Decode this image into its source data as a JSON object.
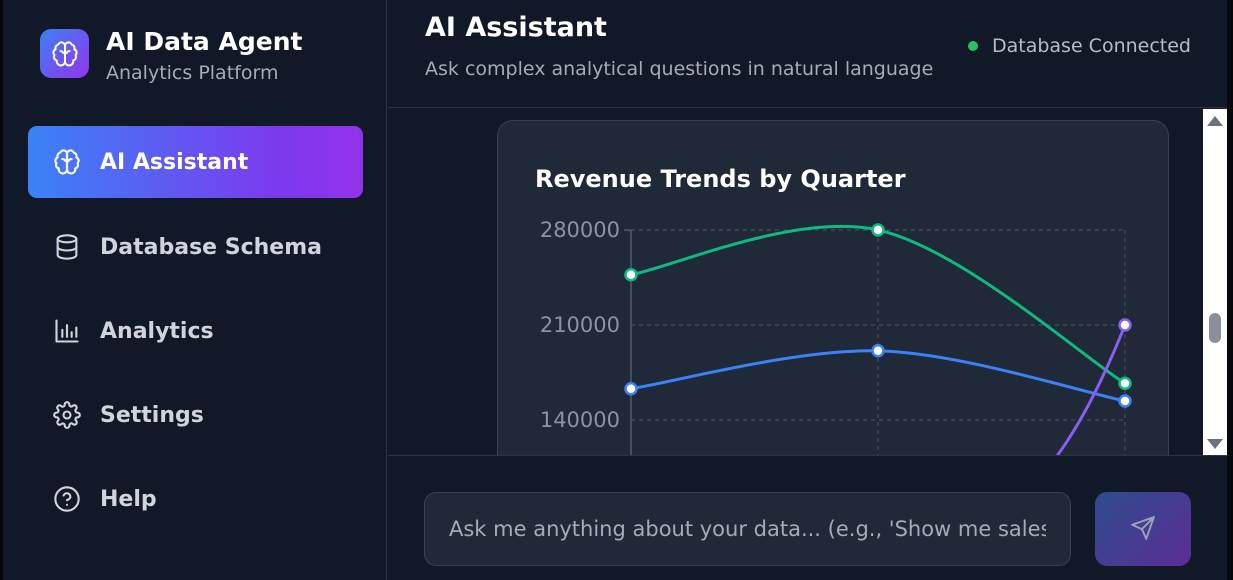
{
  "brand": {
    "title": "AI Data Agent",
    "subtitle": "Analytics Platform",
    "logo_icon": "brain-icon"
  },
  "sidebar": {
    "items": [
      {
        "label": "AI Assistant",
        "icon": "brain-icon",
        "active": true
      },
      {
        "label": "Database Schema",
        "icon": "database-icon",
        "active": false
      },
      {
        "label": "Analytics",
        "icon": "bar-chart-icon",
        "active": false
      },
      {
        "label": "Settings",
        "icon": "gear-icon",
        "active": false
      },
      {
        "label": "Help",
        "icon": "help-circle-icon",
        "active": false
      }
    ]
  },
  "header": {
    "title": "AI Assistant",
    "subtitle": "Ask complex analytical questions in natural language",
    "status": "Database Connected",
    "status_color": "#22c55e"
  },
  "chart_data": {
    "type": "line",
    "title": "Revenue Trends by Quarter",
    "y_ticks": [
      "280000",
      "210000",
      "140000"
    ],
    "grid": true,
    "series": [
      {
        "color": "#10b981",
        "values": [
          247000,
          280000,
          167000
        ]
      },
      {
        "color": "#3b82f6",
        "values": [
          163000,
          191000,
          154000
        ]
      },
      {
        "color": "#8b5cf6",
        "values": [
          null,
          null,
          210000
        ]
      }
    ]
  },
  "composer": {
    "placeholder": "Ask me anything about your data... (e.g., 'Show me sales",
    "send_icon": "send-icon"
  },
  "colors": {
    "accent_from": "#3b82f6",
    "accent_to": "#9333ea",
    "background": "#111827",
    "card": "#1f2937"
  }
}
